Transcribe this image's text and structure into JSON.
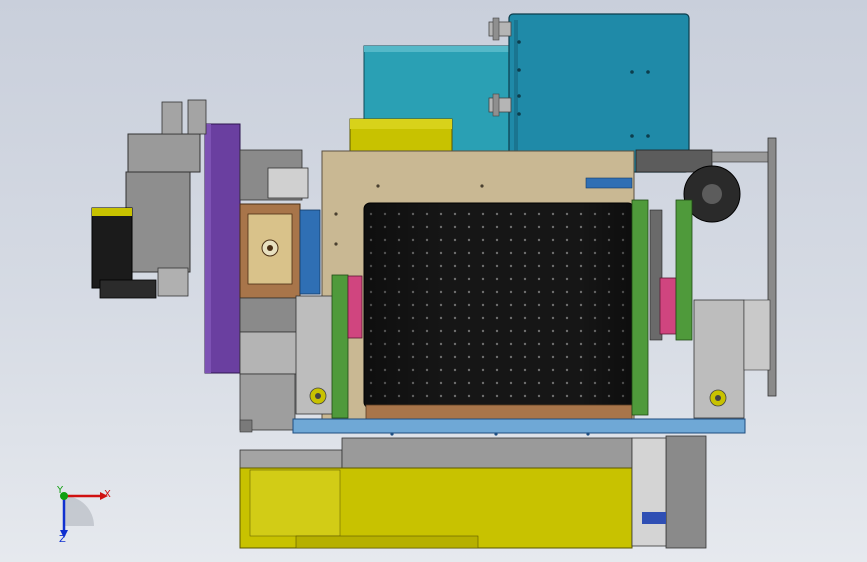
{
  "view": {
    "name": "cad-assembly-front-view",
    "background_top": "#c9cfdb",
    "background_bottom": "#e6e9ee"
  },
  "colors": {
    "teal": "#1f8aa8",
    "teal_dark": "#16677e",
    "cyan_box": "#2aa0b4",
    "olive": "#c8c200",
    "olive_dark": "#8c8700",
    "tan": "#c9b893",
    "purple": "#6a3fa0",
    "drum": "#141414",
    "grey": "#9a9a9a",
    "grey_dark": "#5c5c5c",
    "green": "#4f9a3b",
    "pink": "#d0457f",
    "brown": "#a8754a",
    "blue_plate": "#2f6fb4"
  },
  "icons": {
    "triad": "xyz-axis-triad-icon"
  },
  "triad": {
    "x_label": "X",
    "y_label": "Y",
    "z_label": "Z",
    "x_color": "#d01010",
    "y_color": "#10a010",
    "z_color": "#1030d0"
  }
}
